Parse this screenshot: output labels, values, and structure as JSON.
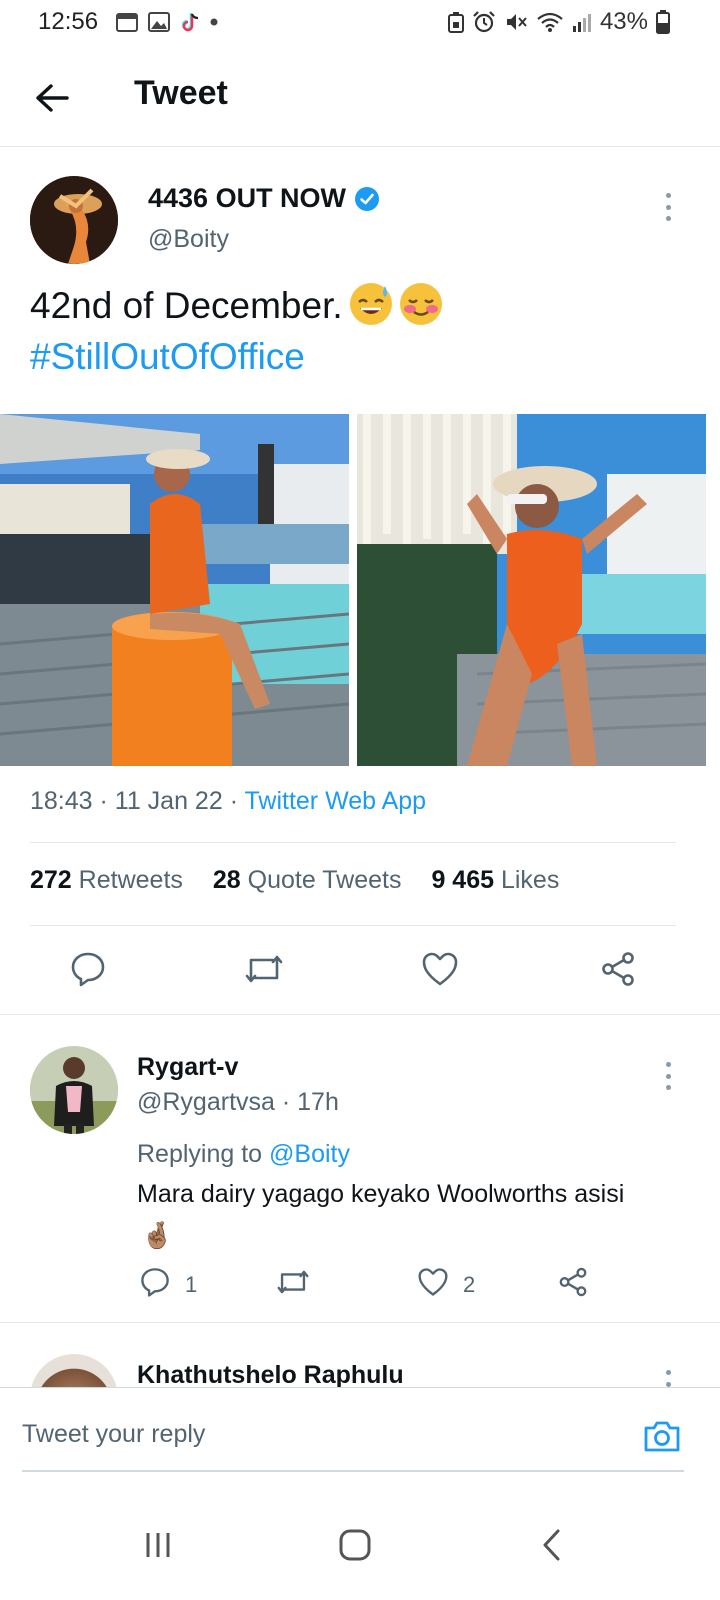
{
  "status_bar": {
    "time": "12:56",
    "battery": "43%"
  },
  "header": {
    "title": "Tweet"
  },
  "tweet": {
    "display_name": "4436 OUT NOW",
    "handle": "@Boity",
    "text": "42nd of December.",
    "emojis": [
      "😅",
      "☺️"
    ],
    "hashtag": "#StillOutOfOffice",
    "time": "18:43",
    "date": "11 Jan 22",
    "source": "Twitter Web App",
    "retweets": "272",
    "retweets_label": "Retweets",
    "quote_tweets": "28",
    "quote_tweets_label": "Quote Tweets",
    "likes": "9 465",
    "likes_label": "Likes"
  },
  "replies": [
    {
      "display_name": "Rygart-v",
      "handle_time": "@Rygartvsa · 17h",
      "replying_prefix": "Replying to",
      "replying_to": "@Boity",
      "text": "Mara dairy yagago keyako Woolworths asisi",
      "emoji": "🤞🏽",
      "reply_count": "1",
      "like_count": "2"
    },
    {
      "display_name": "Khathutshelo Raphulu"
    }
  ],
  "reply_bar": {
    "placeholder": "Tweet your reply"
  },
  "colors": {
    "accent": "#1d9bf0",
    "text_primary": "#0f1419",
    "text_secondary": "#536471"
  }
}
